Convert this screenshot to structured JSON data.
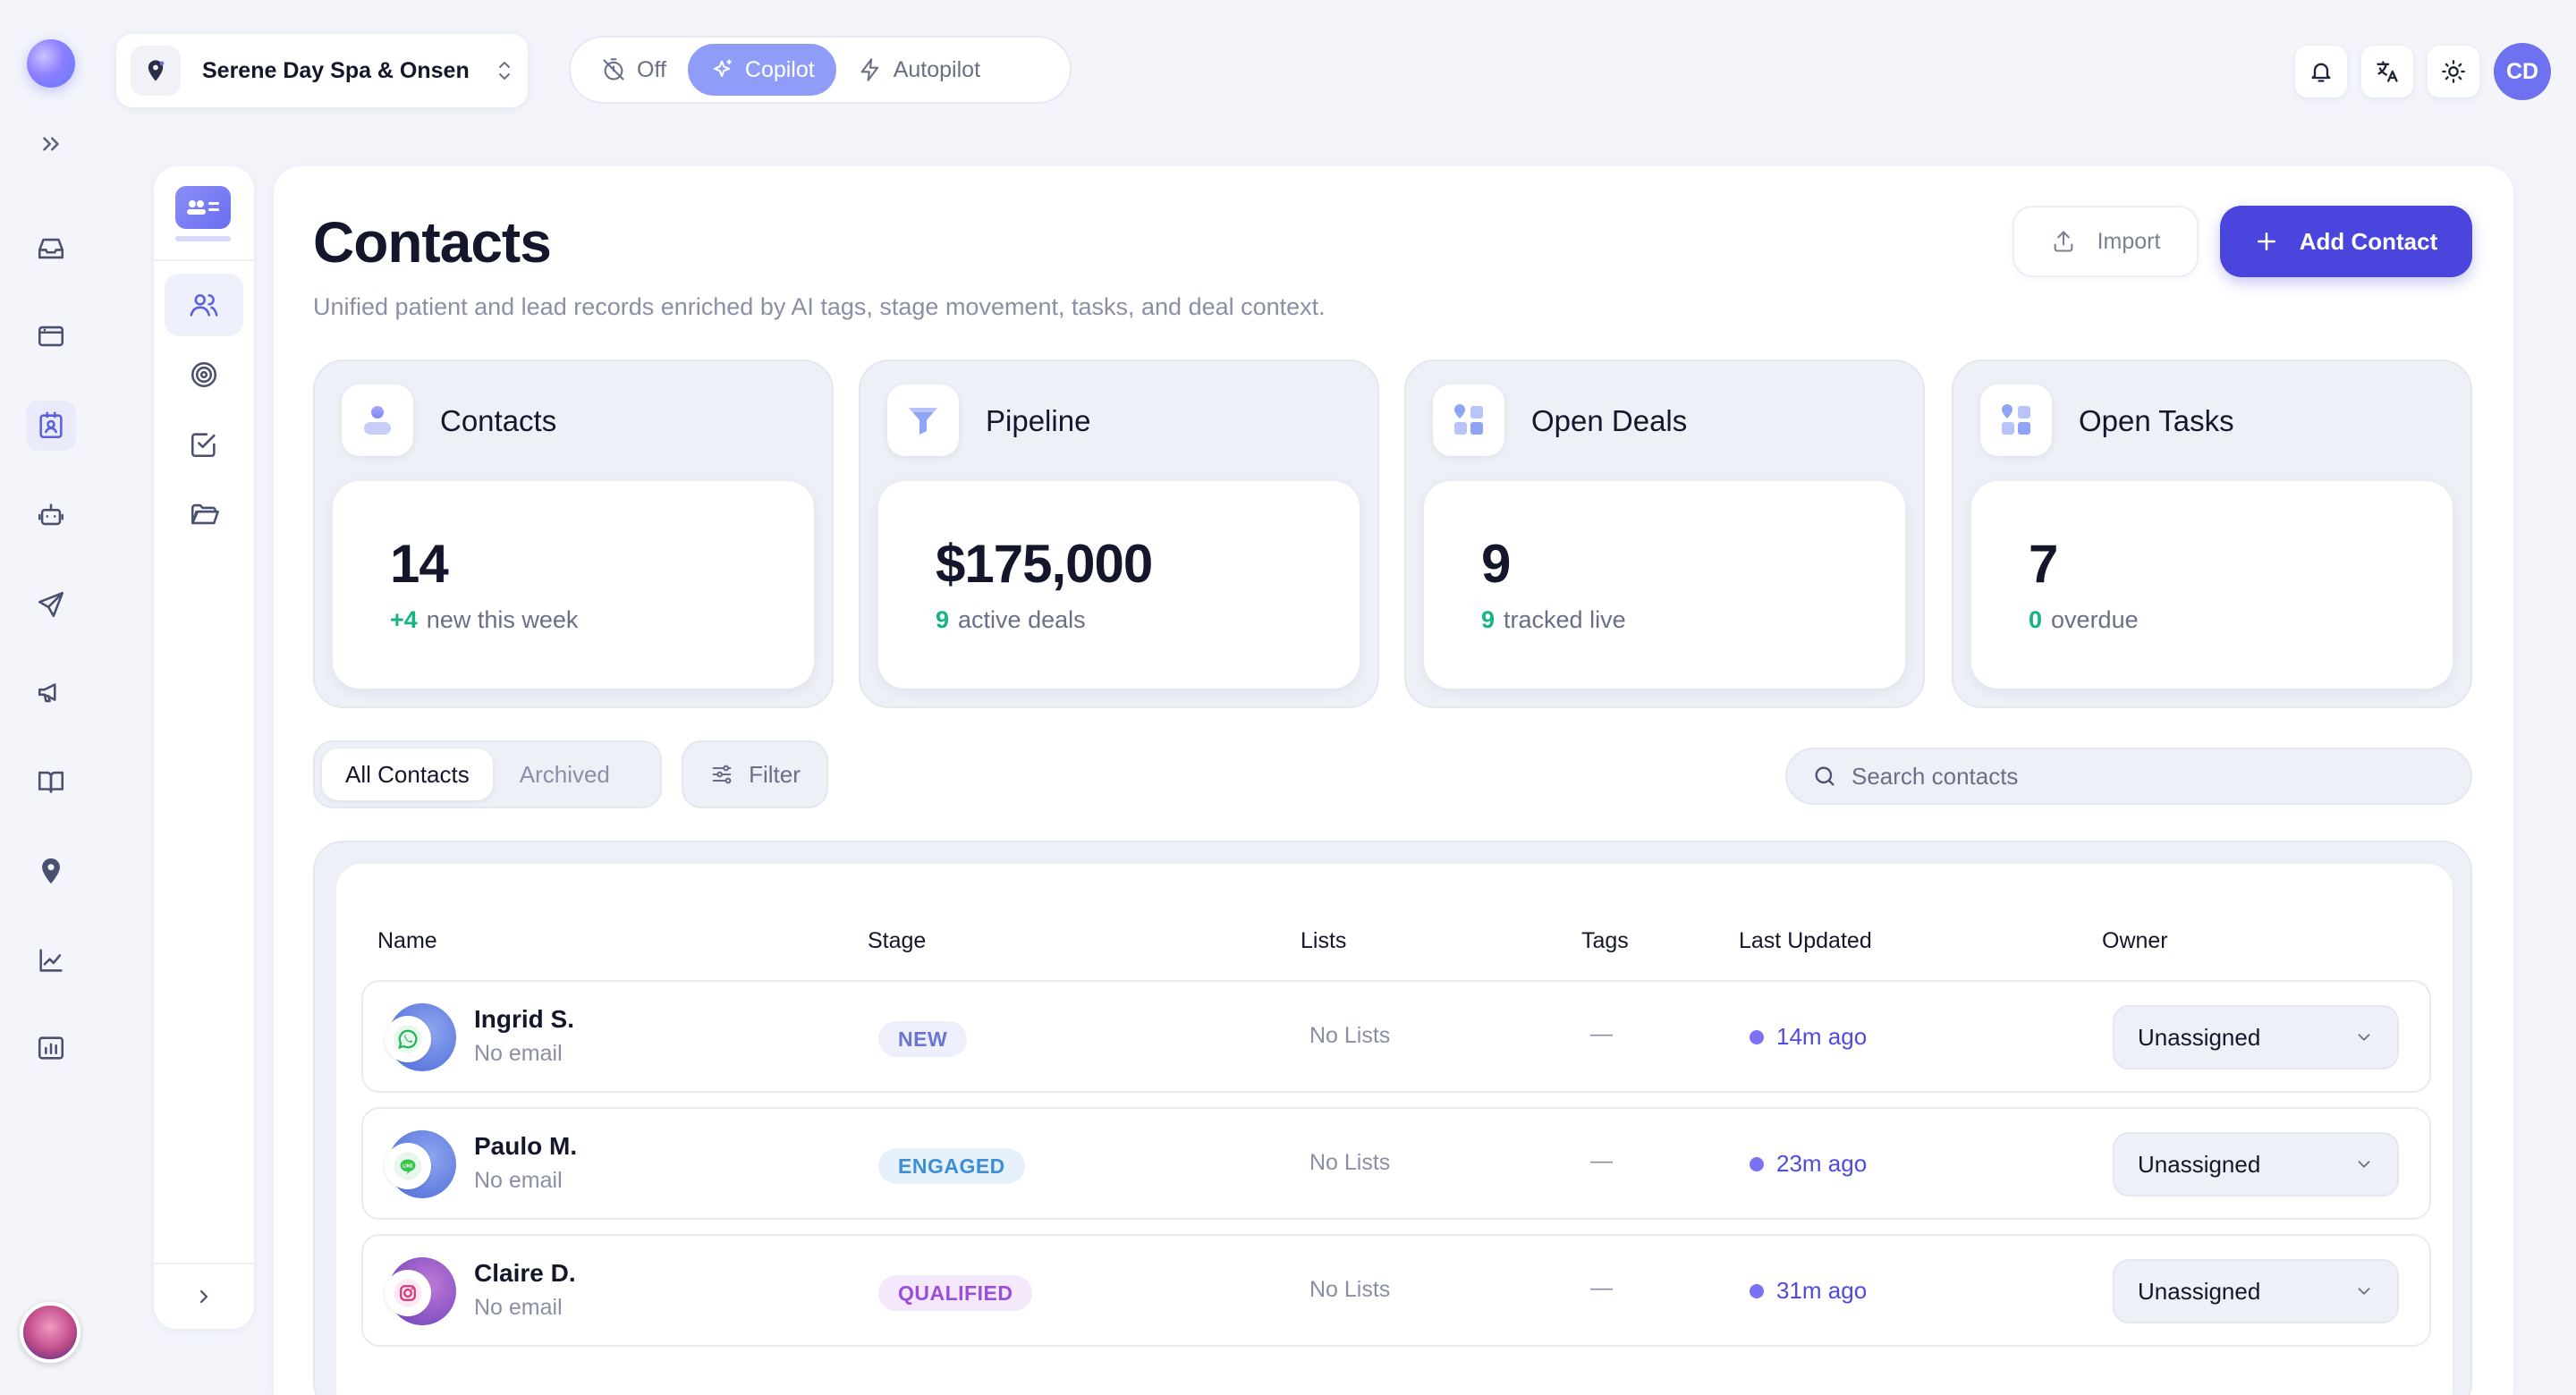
{
  "business": {
    "name": "Serene Day Spa & Onsen"
  },
  "modes": [
    {
      "label": "Off",
      "active": false
    },
    {
      "label": "Copilot",
      "active": true
    },
    {
      "label": "Autopilot",
      "active": false
    }
  ],
  "user": {
    "initials": "CD"
  },
  "page": {
    "title": "Contacts",
    "subtitle": "Unified patient and lead records enriched by AI tags, stage movement, tasks, and deal context.",
    "import_label": "Import",
    "add_label": "Add Contact"
  },
  "stats": [
    {
      "label": "Contacts",
      "value": "14",
      "accent": "+4",
      "note": "new this week"
    },
    {
      "label": "Pipeline",
      "value": "$175,000",
      "accent": "9",
      "note": "active deals"
    },
    {
      "label": "Open Deals",
      "value": "9",
      "accent": "9",
      "note": "tracked live"
    },
    {
      "label": "Open Tasks",
      "value": "7",
      "accent": "0",
      "note": "overdue"
    }
  ],
  "tabs": {
    "all": "All Contacts",
    "archived": "Archived"
  },
  "filter_label": "Filter",
  "search": {
    "placeholder": "Search contacts"
  },
  "table": {
    "headers": {
      "name": "Name",
      "stage": "Stage",
      "lists": "Lists",
      "tags": "Tags",
      "updated": "Last Updated",
      "owner": "Owner"
    },
    "rows": [
      {
        "name": "Ingrid S.",
        "email": "No email",
        "channel": "whatsapp-icon",
        "stage": "NEW",
        "lists": "No Lists",
        "tags": "—",
        "updated": "14m ago",
        "owner": "Unassigned"
      },
      {
        "name": "Paulo M.",
        "email": "No email",
        "channel": "line-icon",
        "stage": "ENGAGED",
        "lists": "No Lists",
        "tags": "—",
        "updated": "23m ago",
        "owner": "Unassigned"
      },
      {
        "name": "Claire D.",
        "email": "No email",
        "channel": "instagram-icon",
        "stage": "QUALIFIED",
        "lists": "No Lists",
        "tags": "—",
        "updated": "31m ago",
        "owner": "Unassigned"
      }
    ]
  },
  "colors": {
    "accent": "#4a45dd",
    "copilot_active": "#8f9df8",
    "positive": "#15b486",
    "stage_new": "#6a74d6",
    "stage_engaged": "#3c8fd6",
    "stage_qualified": "#9b4fd8"
  }
}
